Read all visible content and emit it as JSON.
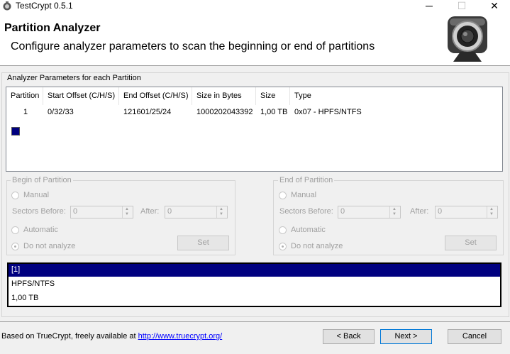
{
  "window": {
    "title": "TestCrypt 0.5.1",
    "minimize": "─",
    "maximize": "☐",
    "close": "✕"
  },
  "header": {
    "title": "Partition Analyzer",
    "subtitle": "Configure analyzer parameters to scan the beginning or end of partitions",
    "logo_icon": "webcam-icon"
  },
  "main_group": {
    "label": "Analyzer Parameters for each Partition"
  },
  "list": {
    "columns": [
      "Partition",
      "Start Offset (C/H/S)",
      "End Offset (C/H/S)",
      "Size in Bytes",
      "Size",
      "Type"
    ],
    "rows": [
      {
        "partition": "1",
        "start": "0/32/33",
        "end": "121601/25/24",
        "bytes": "1000202043392",
        "size": "1,00 TB",
        "type": "0x07 - HPFS/NTFS",
        "color": "#00007f"
      }
    ]
  },
  "begin": {
    "title": "Begin of Partition",
    "manual": "Manual",
    "sectors_before": "Sectors Before:",
    "sectors_before_value": "0",
    "after": "After:",
    "after_value": "0",
    "automatic": "Automatic",
    "do_not_analyze": "Do not analyze",
    "set": "Set"
  },
  "end": {
    "title": "End of Partition",
    "manual": "Manual",
    "sectors_before": "Sectors Before:",
    "sectors_before_value": "0",
    "after": "After:",
    "after_value": "0",
    "automatic": "Automatic",
    "do_not_analyze": "Do not analyze",
    "set": "Set"
  },
  "info": {
    "line1": "[1]",
    "line2": "HPFS/NTFS",
    "line3": "1,00 TB"
  },
  "footer": {
    "text": "Based on TrueCrypt, freely available at ",
    "link": "http://www.truecrypt.org/",
    "back": "< Back",
    "next": "Next >",
    "cancel": "Cancel"
  }
}
